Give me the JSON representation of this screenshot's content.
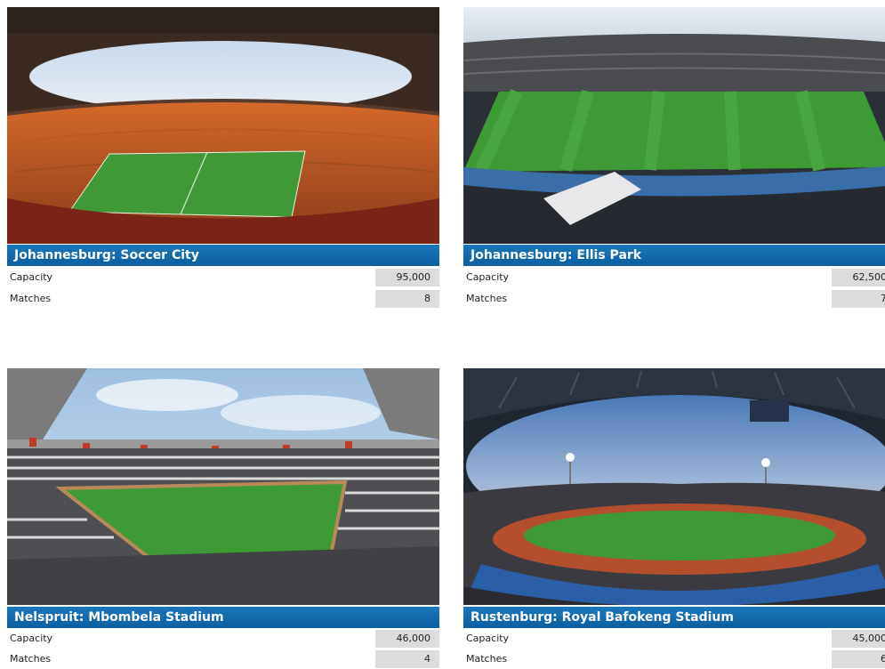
{
  "stadiums": [
    {
      "title": "Johannesburg: Soccer City",
      "capacity_label": "Capacity",
      "capacity": "95,000",
      "matches_label": "Matches",
      "matches": "8"
    },
    {
      "title": "Johannesburg: Ellis Park",
      "capacity_label": "Capacity",
      "capacity": "62,500",
      "matches_label": "Matches",
      "matches": "7"
    },
    {
      "title": "Nelspruit: Mbombela Stadium",
      "capacity_label": "Capacity",
      "capacity": "46,000",
      "matches_label": "Matches",
      "matches": "4"
    },
    {
      "title": "Rustenburg: Royal Bafokeng Stadium",
      "capacity_label": "Capacity",
      "capacity": "45,000",
      "matches_label": "Matches",
      "matches": "6"
    }
  ],
  "colors": {
    "title_bar": "#0f65a6",
    "value_cell": "#dcdcdc",
    "pitch": "#3d9a35"
  }
}
